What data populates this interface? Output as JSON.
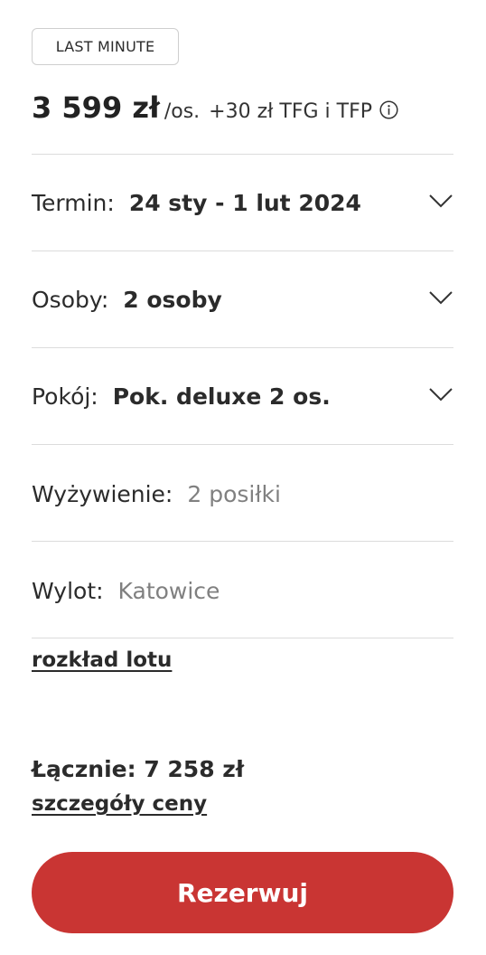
{
  "badge": {
    "label": "LAST MINUTE"
  },
  "price": {
    "amount": "3 599 zł",
    "per": "/os.",
    "extra": "+30 zł TFG i TFP",
    "info_icon": "info-circle-icon"
  },
  "rows": {
    "termin": {
      "label": "Termin:",
      "value": "24 sty - 1 lut 2024",
      "icon": "chevron-down-icon"
    },
    "osoby": {
      "label": "Osoby:",
      "value": "2 osoby",
      "icon": "chevron-down-icon"
    },
    "pokoj": {
      "label": "Pokój:",
      "value": "Pok. deluxe 2 os.",
      "icon": "chevron-down-icon"
    },
    "wyzywienie": {
      "label": "Wyżywienie:",
      "value": "2 posiłki"
    },
    "wylot": {
      "label": "Wylot:",
      "value": "Katowice"
    }
  },
  "links": {
    "flight_schedule": "rozkład lotu",
    "price_details": "szczegóły ceny"
  },
  "total": {
    "text": "Łącznie: 7 258 zł"
  },
  "button": {
    "label": "Rezerwuj"
  },
  "colors": {
    "accent": "#c93533",
    "divider": "#dcdcdc",
    "muted_text": "#808080"
  }
}
